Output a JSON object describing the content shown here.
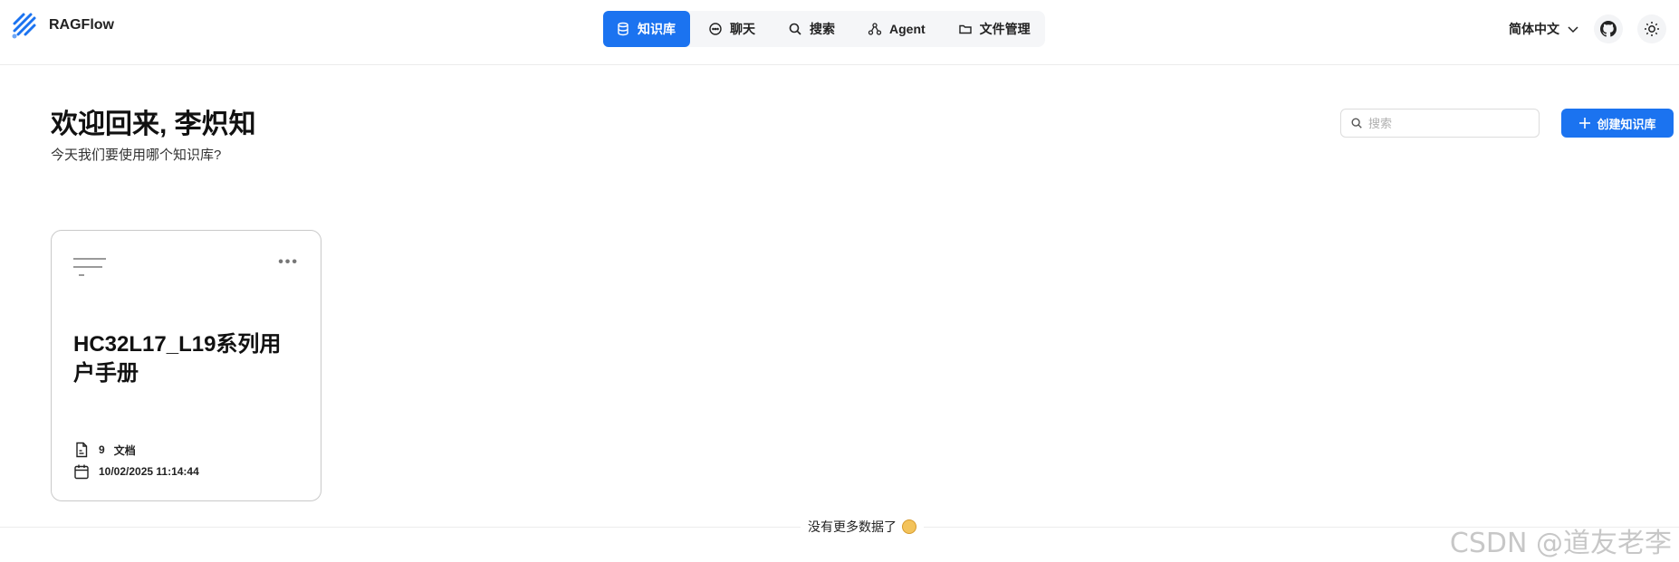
{
  "brand": {
    "name": "RAGFlow"
  },
  "nav": {
    "items": [
      {
        "label": "知识库",
        "icon": "database-icon",
        "active": true
      },
      {
        "label": "聊天",
        "icon": "chat-icon",
        "active": false
      },
      {
        "label": "搜索",
        "icon": "search-icon",
        "active": false
      },
      {
        "label": "Agent",
        "icon": "agent-icon",
        "active": false
      },
      {
        "label": "文件管理",
        "icon": "folder-icon",
        "active": false
      }
    ]
  },
  "header": {
    "language": "简体中文",
    "icons": [
      "chevron-down-icon",
      "github-icon",
      "sun-icon"
    ]
  },
  "welcome": {
    "title": "欢迎回来, 李炽知",
    "subtitle": "今天我们要使用哪个知识库?"
  },
  "search": {
    "placeholder": "搜索"
  },
  "actions": {
    "create_label": "创建知识库"
  },
  "knowledge_bases": [
    {
      "title": "HC32L17_L19系列用户手册",
      "doc_count": "9",
      "doc_label": "文档",
      "updated": "10/02/2025 11:14:44"
    }
  ],
  "footer": {
    "no_more": "没有更多数据了"
  },
  "watermark": "CSDN @道友老李",
  "colors": {
    "accent": "#1b73f0"
  }
}
